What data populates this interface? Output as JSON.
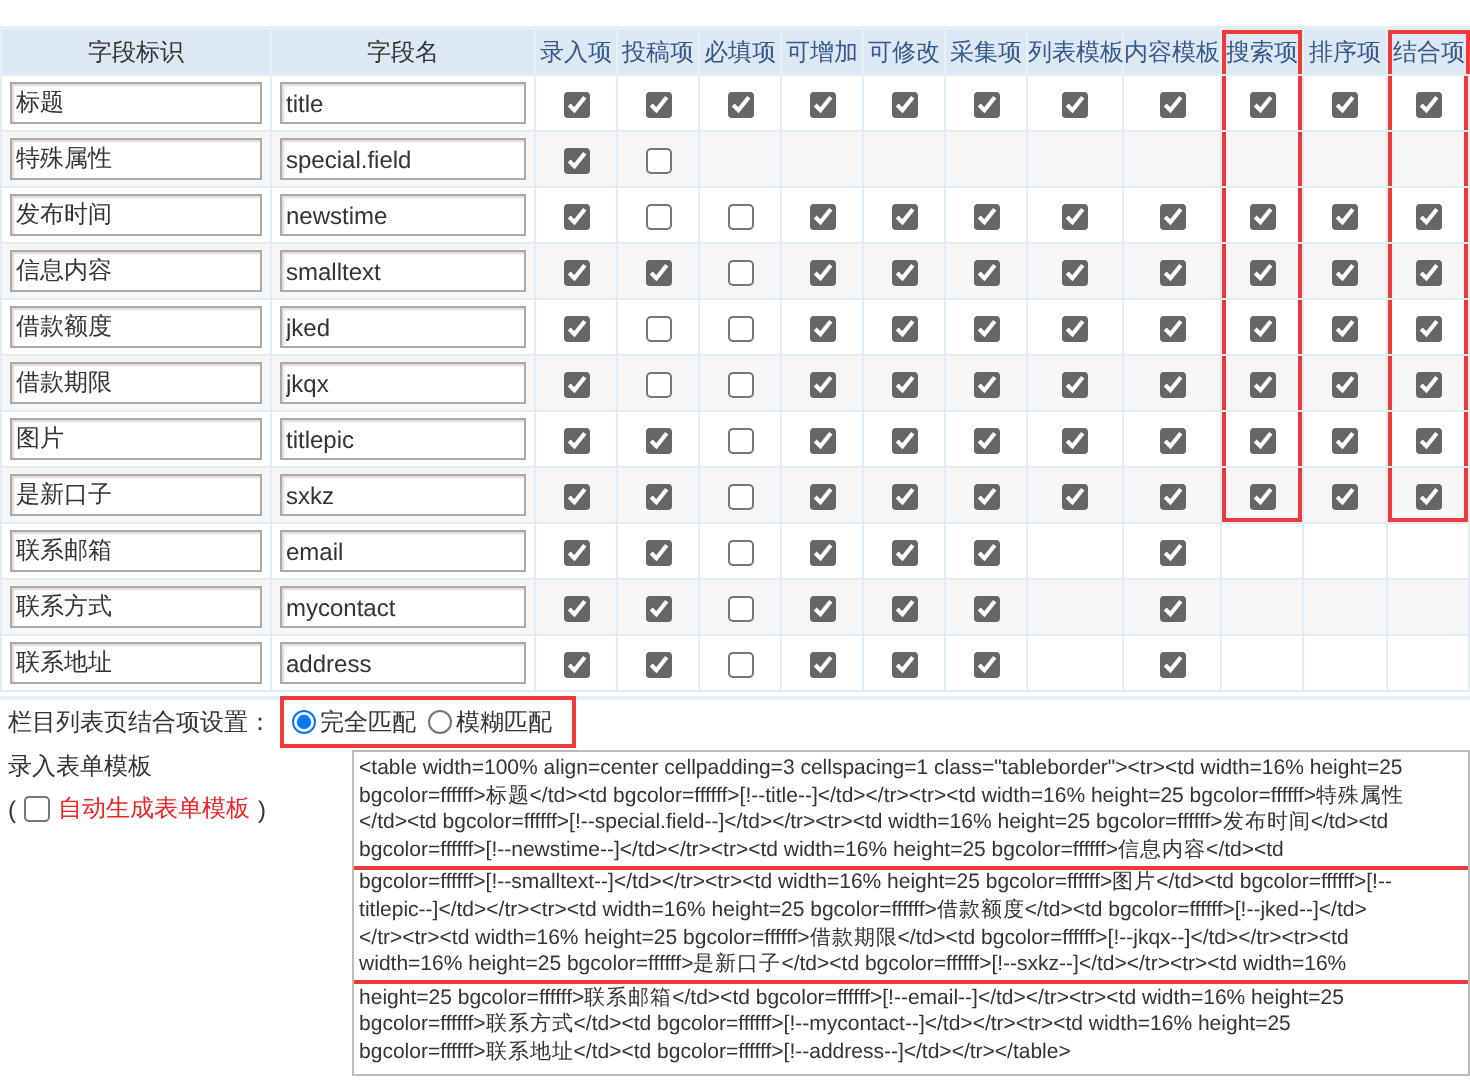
{
  "table": {
    "columns": [
      {
        "label": "字段标识",
        "kind": "text",
        "highlighted": false
      },
      {
        "label": "字段名",
        "kind": "text",
        "highlighted": false
      },
      {
        "label": "录入项",
        "kind": "check",
        "highlighted": false
      },
      {
        "label": "投稿项",
        "kind": "check",
        "highlighted": false
      },
      {
        "label": "必填项",
        "kind": "check",
        "highlighted": false
      },
      {
        "label": "可增加",
        "kind": "check",
        "highlighted": false
      },
      {
        "label": "可修改",
        "kind": "check",
        "highlighted": false
      },
      {
        "label": "采集项",
        "kind": "check",
        "highlighted": false
      },
      {
        "label": "列表模板",
        "kind": "check",
        "highlighted": false
      },
      {
        "label": "内容模板",
        "kind": "check",
        "highlighted": false
      },
      {
        "label": "搜索项",
        "kind": "check",
        "highlighted": true
      },
      {
        "label": "排序项",
        "kind": "check",
        "highlighted": false
      },
      {
        "label": "结合项",
        "kind": "check",
        "highlighted": true
      }
    ],
    "rows": [
      {
        "label": "标题",
        "field": "title",
        "checks": [
          {
            "kind": "box",
            "checked": true
          },
          {
            "kind": "box",
            "checked": true
          },
          {
            "kind": "box",
            "checked": true
          },
          {
            "kind": "box",
            "checked": true
          },
          {
            "kind": "box",
            "checked": true
          },
          {
            "kind": "box",
            "checked": true
          },
          {
            "kind": "box",
            "checked": true
          },
          {
            "kind": "box",
            "checked": true
          },
          {
            "kind": "box",
            "checked": true
          },
          {
            "kind": "box",
            "checked": true
          },
          {
            "kind": "box",
            "checked": true
          }
        ]
      },
      {
        "label": "特殊属性",
        "field": "special.field",
        "checks": [
          {
            "kind": "box",
            "checked": true
          },
          {
            "kind": "box",
            "checked": false
          },
          {
            "kind": "blank"
          },
          {
            "kind": "blank"
          },
          {
            "kind": "blank"
          },
          {
            "kind": "blank"
          },
          {
            "kind": "blank"
          },
          {
            "kind": "blank"
          },
          {
            "kind": "blank"
          },
          {
            "kind": "blank"
          },
          {
            "kind": "blank"
          }
        ]
      },
      {
        "label": "发布时间",
        "field": "newstime",
        "checks": [
          {
            "kind": "box",
            "checked": true
          },
          {
            "kind": "box",
            "checked": false
          },
          {
            "kind": "box",
            "checked": false
          },
          {
            "kind": "box",
            "checked": true
          },
          {
            "kind": "box",
            "checked": true
          },
          {
            "kind": "box",
            "checked": true
          },
          {
            "kind": "box",
            "checked": true
          },
          {
            "kind": "box",
            "checked": true
          },
          {
            "kind": "box",
            "checked": true
          },
          {
            "kind": "box",
            "checked": true
          },
          {
            "kind": "box",
            "checked": true
          }
        ]
      },
      {
        "label": "信息内容",
        "field": "smalltext",
        "checks": [
          {
            "kind": "box",
            "checked": true
          },
          {
            "kind": "box",
            "checked": true
          },
          {
            "kind": "box",
            "checked": false
          },
          {
            "kind": "box",
            "checked": true
          },
          {
            "kind": "box",
            "checked": true
          },
          {
            "kind": "box",
            "checked": true
          },
          {
            "kind": "box",
            "checked": true
          },
          {
            "kind": "box",
            "checked": true
          },
          {
            "kind": "box",
            "checked": true
          },
          {
            "kind": "box",
            "checked": true
          },
          {
            "kind": "box",
            "checked": true
          }
        ]
      },
      {
        "label": "借款额度",
        "field": "jked",
        "checks": [
          {
            "kind": "box",
            "checked": true
          },
          {
            "kind": "box",
            "checked": false
          },
          {
            "kind": "box",
            "checked": false
          },
          {
            "kind": "box",
            "checked": true
          },
          {
            "kind": "box",
            "checked": true
          },
          {
            "kind": "box",
            "checked": true
          },
          {
            "kind": "box",
            "checked": true
          },
          {
            "kind": "box",
            "checked": true
          },
          {
            "kind": "box",
            "checked": true
          },
          {
            "kind": "box",
            "checked": true
          },
          {
            "kind": "box",
            "checked": true
          }
        ]
      },
      {
        "label": "借款期限",
        "field": "jkqx",
        "checks": [
          {
            "kind": "box",
            "checked": true
          },
          {
            "kind": "box",
            "checked": false
          },
          {
            "kind": "box",
            "checked": false
          },
          {
            "kind": "box",
            "checked": true
          },
          {
            "kind": "box",
            "checked": true
          },
          {
            "kind": "box",
            "checked": true
          },
          {
            "kind": "box",
            "checked": true
          },
          {
            "kind": "box",
            "checked": true
          },
          {
            "kind": "box",
            "checked": true
          },
          {
            "kind": "box",
            "checked": true
          },
          {
            "kind": "box",
            "checked": true
          }
        ]
      },
      {
        "label": "图片",
        "field": "titlepic",
        "checks": [
          {
            "kind": "box",
            "checked": true
          },
          {
            "kind": "box",
            "checked": true
          },
          {
            "kind": "box",
            "checked": false
          },
          {
            "kind": "box",
            "checked": true
          },
          {
            "kind": "box",
            "checked": true
          },
          {
            "kind": "box",
            "checked": true
          },
          {
            "kind": "box",
            "checked": true
          },
          {
            "kind": "box",
            "checked": true
          },
          {
            "kind": "box",
            "checked": true
          },
          {
            "kind": "box",
            "checked": true
          },
          {
            "kind": "box",
            "checked": true
          }
        ]
      },
      {
        "label": "是新口子",
        "field": "sxkz",
        "checks": [
          {
            "kind": "box",
            "checked": true
          },
          {
            "kind": "box",
            "checked": true
          },
          {
            "kind": "box",
            "checked": false
          },
          {
            "kind": "box",
            "checked": true
          },
          {
            "kind": "box",
            "checked": true
          },
          {
            "kind": "box",
            "checked": true
          },
          {
            "kind": "box",
            "checked": true
          },
          {
            "kind": "box",
            "checked": true
          },
          {
            "kind": "box",
            "checked": true
          },
          {
            "kind": "box",
            "checked": true
          },
          {
            "kind": "box",
            "checked": true
          }
        ]
      },
      {
        "label": "联系邮箱",
        "field": "email",
        "checks": [
          {
            "kind": "box",
            "checked": true
          },
          {
            "kind": "box",
            "checked": true
          },
          {
            "kind": "box",
            "checked": false
          },
          {
            "kind": "box",
            "checked": true
          },
          {
            "kind": "box",
            "checked": true
          },
          {
            "kind": "box",
            "checked": true
          },
          {
            "kind": "blank"
          },
          {
            "kind": "box",
            "checked": true
          },
          {
            "kind": "blank"
          },
          {
            "kind": "blank"
          },
          {
            "kind": "blank"
          }
        ]
      },
      {
        "label": "联系方式",
        "field": "mycontact",
        "checks": [
          {
            "kind": "box",
            "checked": true
          },
          {
            "kind": "box",
            "checked": true
          },
          {
            "kind": "box",
            "checked": false
          },
          {
            "kind": "box",
            "checked": true
          },
          {
            "kind": "box",
            "checked": true
          },
          {
            "kind": "box",
            "checked": true
          },
          {
            "kind": "blank"
          },
          {
            "kind": "box",
            "checked": true
          },
          {
            "kind": "blank"
          },
          {
            "kind": "blank"
          },
          {
            "kind": "blank"
          }
        ]
      },
      {
        "label": "联系地址",
        "field": "address",
        "checks": [
          {
            "kind": "box",
            "checked": true
          },
          {
            "kind": "box",
            "checked": true
          },
          {
            "kind": "box",
            "checked": false
          },
          {
            "kind": "box",
            "checked": true
          },
          {
            "kind": "box",
            "checked": true
          },
          {
            "kind": "box",
            "checked": true
          },
          {
            "kind": "blank"
          },
          {
            "kind": "box",
            "checked": true
          },
          {
            "kind": "blank"
          },
          {
            "kind": "blank"
          },
          {
            "kind": "blank"
          }
        ]
      }
    ]
  },
  "match_setting": {
    "label": "栏目列表页结合项设置：",
    "highlighted": true,
    "options": [
      {
        "label": "完全匹配",
        "selected": true
      },
      {
        "label": "模糊匹配",
        "selected": false
      }
    ]
  },
  "form_template": {
    "label": "录入表单模板",
    "open_paren": "(",
    "auto_generate": {
      "label": "自动生成表单模板",
      "checked": false
    },
    "close_paren": ")",
    "lines": [
      {
        "text": "<table width=100% align=center cellpadding=3 cellspacing=1 class=\"tableborder\"><tr><td width=16% height=25",
        "highlighted": false
      },
      {
        "text": "bgcolor=ffffff>标题</td><td bgcolor=ffffff>[!--title--]</td></tr><tr><td width=16% height=25 bgcolor=ffffff>特殊属性",
        "highlighted": false
      },
      {
        "text": "</td><td bgcolor=ffffff>[!--special.field--]</td></tr><tr><td width=16% height=25 bgcolor=ffffff>发布时间</td><td",
        "highlighted": false
      },
      {
        "text": "bgcolor=ffffff>[!--newstime--]</td></tr><tr><td width=16% height=25 bgcolor=ffffff>信息内容</td><td",
        "highlighted": false
      },
      {
        "text": "bgcolor=ffffff>[!--smalltext--]</td></tr><tr><td width=16% height=25 bgcolor=ffffff>图片</td><td bgcolor=ffffff>[!--",
        "highlighted": true
      },
      {
        "text": "titlepic--]</td></tr><tr><td width=16% height=25 bgcolor=ffffff>借款额度</td><td bgcolor=ffffff>[!--jked--]</td>",
        "highlighted": true
      },
      {
        "text": "</tr><tr><td width=16% height=25 bgcolor=ffffff>借款期限</td><td bgcolor=ffffff>[!--jkqx--]</td></tr><tr><td",
        "highlighted": true
      },
      {
        "text": "width=16% height=25 bgcolor=ffffff>是新口子</td><td bgcolor=ffffff>[!--sxkz--]</td></tr><tr><td width=16%",
        "highlighted": true
      },
      {
        "text": "height=25 bgcolor=ffffff>联系邮箱</td><td bgcolor=ffffff>[!--email--]</td></tr><tr><td width=16% height=25",
        "highlighted": false
      },
      {
        "text": "bgcolor=ffffff>联系方式</td><td bgcolor=ffffff>[!--mycontact--]</td></tr><tr><td width=16% height=25",
        "highlighted": false
      },
      {
        "text": "bgcolor=ffffff>联系地址</td><td bgcolor=ffffff>[!--address--]</td></tr></table>",
        "highlighted": false
      }
    ]
  }
}
